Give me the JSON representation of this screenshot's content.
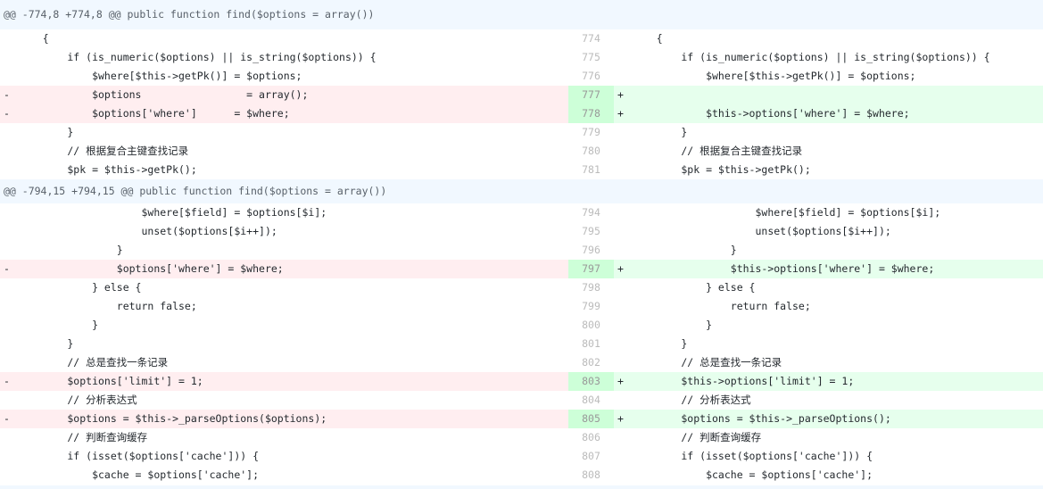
{
  "hunks": [
    {
      "header": "@@ -774,8 +774,8 @@ public function find($options = array())",
      "rows": [
        {
          "lt": "n",
          "ln": "",
          "lc": "    {",
          "rt": "n",
          "rn": "774",
          "rc": "    {"
        },
        {
          "lt": "n",
          "ln": "",
          "lc": "        if (is_numeric($options) || is_string($options)) {",
          "rt": "n",
          "rn": "775",
          "rc": "        if (is_numeric($options) || is_string($options)) {"
        },
        {
          "lt": "n",
          "ln": "",
          "lc": "            $where[$this->getPk()] = $options;",
          "rt": "n",
          "rn": "776",
          "rc": "            $where[$this->getPk()] = $options;"
        },
        {
          "lt": "d",
          "ln": "",
          "lc": "            $options                 = array();",
          "rt": "a",
          "rn": "777",
          "rc": ""
        },
        {
          "lt": "d",
          "ln": "",
          "lc": "            $options['where']      = $where;",
          "rt": "a",
          "rn": "778",
          "rc": "            $this->options['where'] = $where;"
        },
        {
          "lt": "n",
          "ln": "",
          "lc": "        }",
          "rt": "n",
          "rn": "779",
          "rc": "        }"
        },
        {
          "lt": "n",
          "ln": "",
          "lc": "        // 根据复合主键查找记录",
          "rt": "n",
          "rn": "780",
          "rc": "        // 根据复合主键查找记录"
        },
        {
          "lt": "n",
          "ln": "",
          "lc": "        $pk = $this->getPk();",
          "rt": "n",
          "rn": "781",
          "rc": "        $pk = $this->getPk();"
        }
      ]
    },
    {
      "header": "@@ -794,15 +794,15 @@ public function find($options = array())",
      "rows": [
        {
          "lt": "n",
          "ln": "",
          "lc": "                    $where[$field] = $options[$i];",
          "rt": "n",
          "rn": "794",
          "rc": "                    $where[$field] = $options[$i];"
        },
        {
          "lt": "n",
          "ln": "",
          "lc": "                    unset($options[$i++]);",
          "rt": "n",
          "rn": "795",
          "rc": "                    unset($options[$i++]);"
        },
        {
          "lt": "n",
          "ln": "",
          "lc": "                }",
          "rt": "n",
          "rn": "796",
          "rc": "                }"
        },
        {
          "lt": "d",
          "ln": "",
          "lc": "                $options['where'] = $where;",
          "rt": "a",
          "rn": "797",
          "rc": "                $this->options['where'] = $where;"
        },
        {
          "lt": "n",
          "ln": "",
          "lc": "            } else {",
          "rt": "n",
          "rn": "798",
          "rc": "            } else {"
        },
        {
          "lt": "n",
          "ln": "",
          "lc": "                return false;",
          "rt": "n",
          "rn": "799",
          "rc": "                return false;"
        },
        {
          "lt": "n",
          "ln": "",
          "lc": "            }",
          "rt": "n",
          "rn": "800",
          "rc": "            }"
        },
        {
          "lt": "n",
          "ln": "",
          "lc": "        }",
          "rt": "n",
          "rn": "801",
          "rc": "        }"
        },
        {
          "lt": "n",
          "ln": "",
          "lc": "        // 总是查找一条记录",
          "rt": "n",
          "rn": "802",
          "rc": "        // 总是查找一条记录"
        },
        {
          "lt": "d",
          "ln": "",
          "lc": "        $options['limit'] = 1;",
          "rt": "a",
          "rn": "803",
          "rc": "        $this->options['limit'] = 1;"
        },
        {
          "lt": "n",
          "ln": "",
          "lc": "        // 分析表达式",
          "rt": "n",
          "rn": "804",
          "rc": "        // 分析表达式"
        },
        {
          "lt": "d",
          "ln": "",
          "lc": "        $options = $this->_parseOptions($options);",
          "rt": "a",
          "rn": "805",
          "rc": "        $options = $this->_parseOptions();"
        },
        {
          "lt": "n",
          "ln": "",
          "lc": "        // 判断查询缓存",
          "rt": "n",
          "rn": "806",
          "rc": "        // 判断查询缓存"
        },
        {
          "lt": "n",
          "ln": "",
          "lc": "        if (isset($options['cache'])) {",
          "rt": "n",
          "rn": "807",
          "rc": "        if (isset($options['cache'])) {"
        },
        {
          "lt": "n",
          "ln": "",
          "lc": "            $cache = $options['cache'];",
          "rt": "n",
          "rn": "808",
          "rc": "            $cache = $options['cache'];"
        }
      ]
    }
  ],
  "markers": {
    "del": "-",
    "add": "+"
  },
  "colors": {
    "del_bg": "#ffeef0",
    "add_bg": "#e6ffed",
    "hunk_bg": "#f1f8ff"
  }
}
